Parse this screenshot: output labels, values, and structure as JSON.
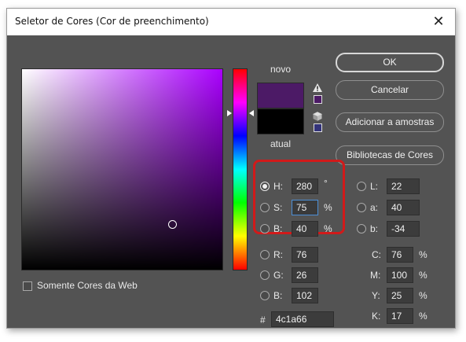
{
  "window": {
    "title": "Seletor de Cores (Cor de preenchimento)",
    "close_glyph": "✕"
  },
  "preview": {
    "new_label": "novo",
    "current_label": "atual",
    "new_color": "#4c1a66",
    "current_color": "#000000"
  },
  "buttons": {
    "ok": "OK",
    "cancel": "Cancelar",
    "add_to_swatches": "Adicionar a amostras",
    "color_libraries": "Bibliotecas de Cores"
  },
  "hsb": {
    "h": {
      "label": "H:",
      "value": "280",
      "unit": "°"
    },
    "s": {
      "label": "S:",
      "value": "75",
      "unit": "%"
    },
    "b": {
      "label": "B:",
      "value": "40",
      "unit": "%"
    }
  },
  "rgb": {
    "r": {
      "label": "R:",
      "value": "76"
    },
    "g": {
      "label": "G:",
      "value": "26"
    },
    "b": {
      "label": "B:",
      "value": "102"
    }
  },
  "lab": {
    "l": {
      "label": "L:",
      "value": "22"
    },
    "a": {
      "label": "a:",
      "value": "40"
    },
    "b": {
      "label": "b:",
      "value": "-34"
    }
  },
  "cmyk": {
    "c": {
      "label": "C:",
      "value": "76",
      "unit": "%"
    },
    "m": {
      "label": "M:",
      "value": "100",
      "unit": "%"
    },
    "y": {
      "label": "Y:",
      "value": "25",
      "unit": "%"
    },
    "k": {
      "label": "K:",
      "value": "17",
      "unit": "%"
    }
  },
  "hex": {
    "label": "#",
    "value": "4c1a66"
  },
  "web_only": {
    "label": "Somente Cores da Web",
    "checked": false
  },
  "selected_mode": "H",
  "icons": [
    "warning-icon",
    "cube-icon"
  ],
  "colors": {
    "highlight": "#d11a1a",
    "focus": "#4c8fd6"
  }
}
